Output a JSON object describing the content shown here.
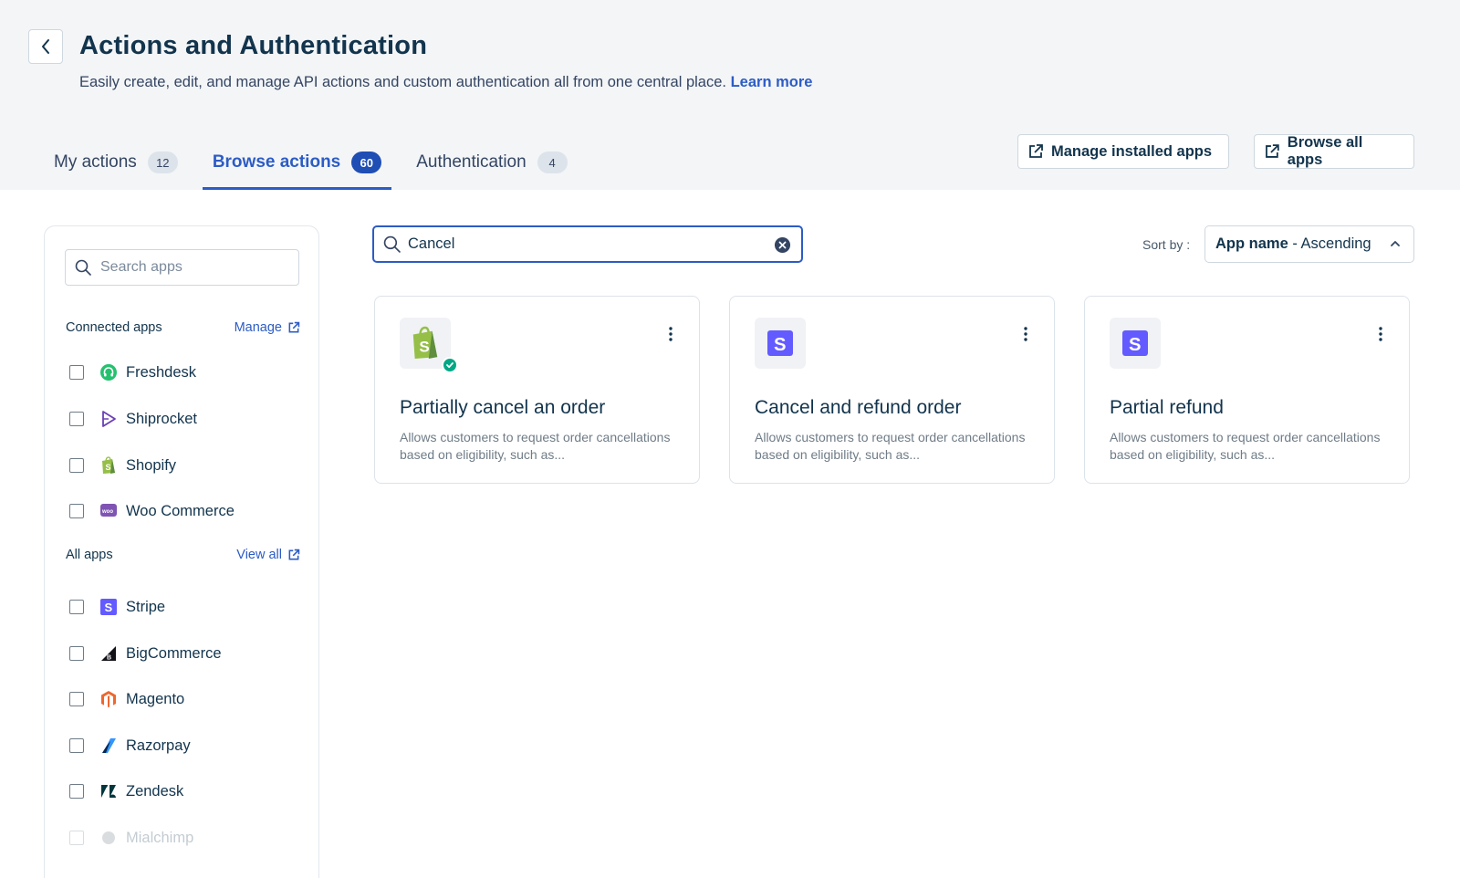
{
  "header": {
    "title": "Actions and Authentication",
    "subtitle": "Easily create, edit, and manage API actions and custom authentication all from one central place.",
    "learn_more": "Learn more"
  },
  "tabs": [
    {
      "label": "My actions",
      "count": "12",
      "active": false
    },
    {
      "label": "Browse actions",
      "count": "60",
      "active": true
    },
    {
      "label": "Authentication",
      "count": "4",
      "active": false
    }
  ],
  "header_buttons": {
    "manage_installed": "Manage installed apps",
    "browse_all": "Browse all apps"
  },
  "sidebar": {
    "search_placeholder": "Search apps",
    "connected": {
      "title": "Connected apps",
      "link": "Manage",
      "apps": [
        "Freshdesk",
        "Shiprocket",
        "Shopify",
        "Woo Commerce"
      ]
    },
    "all": {
      "title": "All apps",
      "link": "View all",
      "apps": [
        "Stripe",
        "BigCommerce",
        "Magento",
        "Razorpay",
        "Zendesk",
        "Mialchimp"
      ]
    }
  },
  "search": {
    "value": "Cancel"
  },
  "sort": {
    "label": "Sort by :",
    "field": "App name",
    "separator": " - ",
    "order": "Ascending"
  },
  "cards": [
    {
      "title": "Partially cancel an order",
      "desc": "Allows customers to request order cancellations based on eligibility, such as...",
      "icon": "shopify-icon"
    },
    {
      "title": "Cancel and refund order",
      "desc": "Allows customers to request order cancellations based on eligibility, such as...",
      "icon": "stripe-icon"
    },
    {
      "title": "Partial refund",
      "desc": "Allows customers to request order cancellations based on eligibility, such as...",
      "icon": "stripe-icon"
    }
  ],
  "colors": {
    "accent": "#2c5cc5",
    "text": "#12344d",
    "header_bg": "#f3f5f7",
    "verified": "#00a886"
  }
}
